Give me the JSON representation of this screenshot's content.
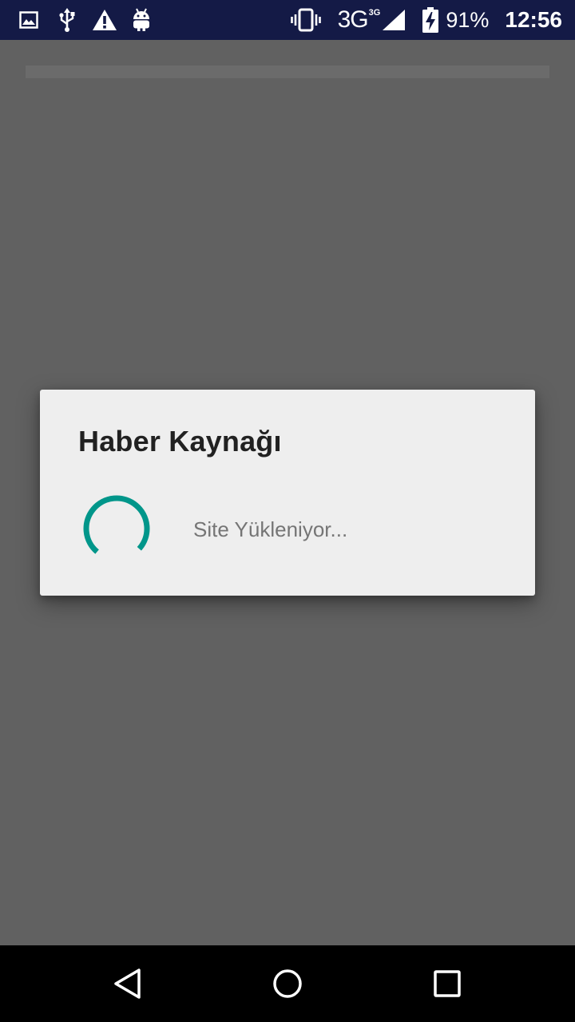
{
  "status_bar": {
    "network": "3G",
    "network_sup": "3G",
    "battery": "91%",
    "time": "12:56",
    "background": "#141a46",
    "left_icons": [
      "image-icon",
      "usb-icon",
      "warning-icon",
      "android-icon"
    ],
    "right_icons": [
      "vibrate-icon",
      "signal-icon",
      "battery-charging-icon"
    ]
  },
  "dialog": {
    "title": "Haber Kaynağı",
    "message": "Site Yükleniyor...",
    "spinner_color": "#00968a",
    "background": "#eeeeee"
  },
  "nav_bar": {
    "icons": [
      "back-icon",
      "home-icon",
      "recents-icon"
    ]
  },
  "colors": {
    "scrim": "#616161",
    "accent": "#00968a"
  }
}
